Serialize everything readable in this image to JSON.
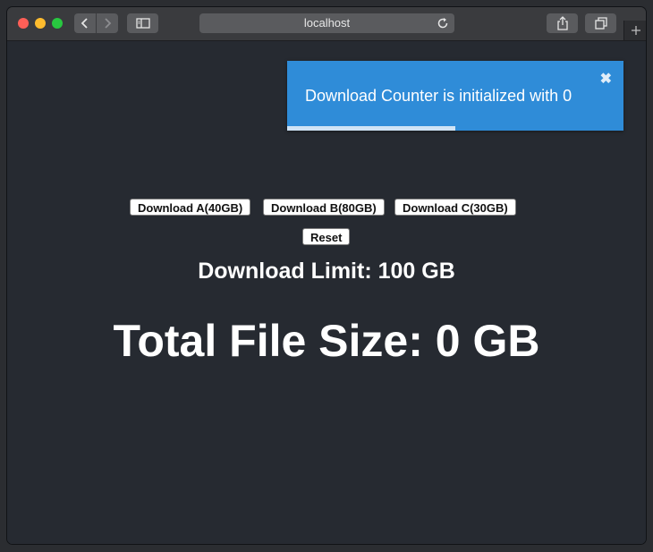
{
  "browser": {
    "address": "localhost"
  },
  "toast": {
    "message": "Download Counter is initialized with 0",
    "close_glyph": "✖",
    "progress_fraction": 0.5,
    "color": "#2f8cd8"
  },
  "downloads": {
    "a_label": "Download A(40GB)",
    "b_label": "Download B(80GB)",
    "c_label": "Download C(30GB)",
    "reset_label": "Reset"
  },
  "limit_text": "Download Limit: 100 GB",
  "total_text": "Total File Size: 0 GB"
}
